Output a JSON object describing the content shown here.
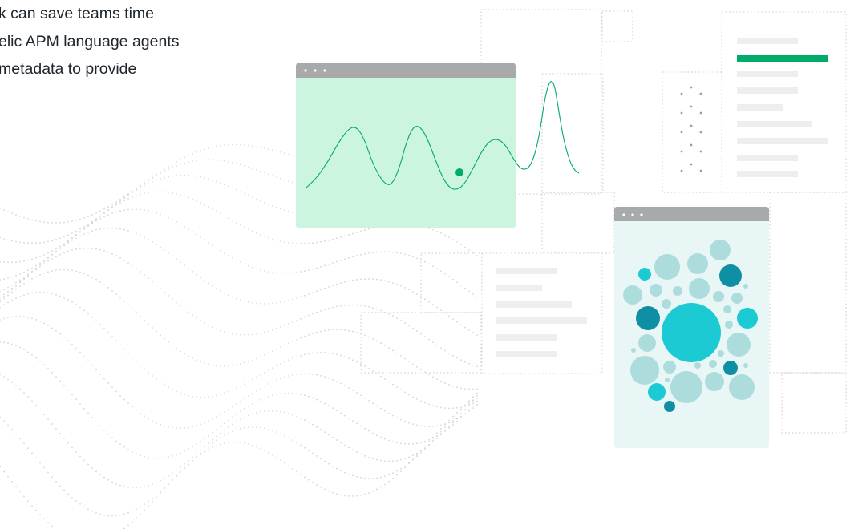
{
  "hero": {
    "lines": [
      "k can save teams time",
      "elic APM language agents",
      "metadata to provide"
    ]
  },
  "colors": {
    "text": "#1d252c",
    "window_chrome": "#a7a9ab",
    "wave_panel_bg": "#ccf5e0",
    "wave_line": "#00ac69",
    "bubble_panel_bg": "#e8f6f6",
    "highlight_bar": "#00ac69",
    "placeholder_bar": "#eeeeee",
    "bubble_light": "#addcdc",
    "bubble_bright": "#1ccad4",
    "bubble_dark": "#0e8fa3"
  },
  "icons": [
    "window-dots-icon",
    "data-point-marker-icon"
  ]
}
